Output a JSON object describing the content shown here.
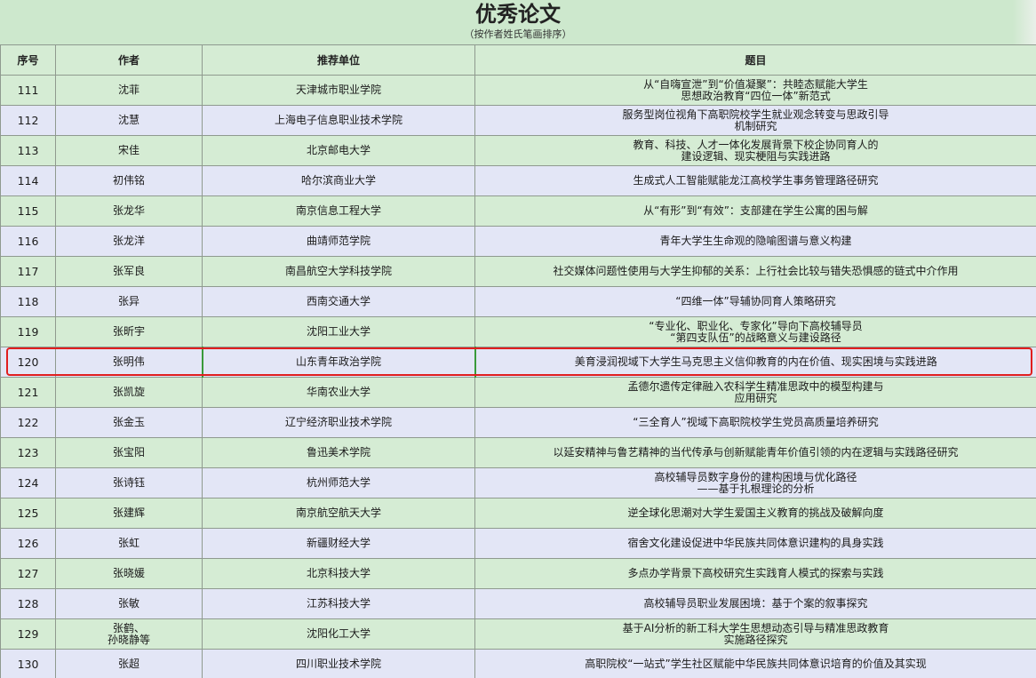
{
  "header": {
    "title": "优秀论文",
    "subtitle": "（按作者姓氏笔画排序）"
  },
  "columns": [
    "序号",
    "作者",
    "推荐单位",
    "题目"
  ],
  "rows": [
    {
      "seq": "111",
      "author": [
        "沈菲"
      ],
      "unit": "天津城市职业学院",
      "topic": [
        "从“自嗨宣泄”到“价值凝聚”：共睦态赋能大学生",
        "思想政治教育“四位一体”新范式"
      ]
    },
    {
      "seq": "112",
      "author": [
        "沈慧"
      ],
      "unit": "上海电子信息职业技术学院",
      "topic": [
        "服务型岗位视角下高职院校学生就业观念转变与思政引导",
        "机制研究"
      ]
    },
    {
      "seq": "113",
      "author": [
        "宋佳"
      ],
      "unit": "北京邮电大学",
      "topic": [
        "教育、科技、人才一体化发展背景下校企协同育人的",
        "建设逻辑、现实梗阻与实践进路"
      ]
    },
    {
      "seq": "114",
      "author": [
        "初伟铭"
      ],
      "unit": "哈尔滨商业大学",
      "topic": [
        "生成式人工智能赋能龙江高校学生事务管理路径研究"
      ]
    },
    {
      "seq": "115",
      "author": [
        "张龙华"
      ],
      "unit": "南京信息工程大学",
      "topic": [
        "从“有形”到“有效”：支部建在学生公寓的困与解"
      ]
    },
    {
      "seq": "116",
      "author": [
        "张龙洋"
      ],
      "unit": "曲靖师范学院",
      "topic": [
        "青年大学生生命观的隐喻图谱与意义构建"
      ]
    },
    {
      "seq": "117",
      "author": [
        "张军良"
      ],
      "unit": "南昌航空大学科技学院",
      "topic": [
        "社交媒体问题性使用与大学生抑郁的关系：上行社会比较与错失恐惧感的链式中介作用"
      ]
    },
    {
      "seq": "118",
      "author": [
        "张异"
      ],
      "unit": "西南交通大学",
      "topic": [
        "“四维一体”导辅协同育人策略研究"
      ]
    },
    {
      "seq": "119",
      "author": [
        "张昕宇"
      ],
      "unit": "沈阳工业大学",
      "topic": [
        "“专业化、职业化、专家化”导向下高校辅导员",
        "“第四支队伍”的战略意义与建设路径"
      ]
    },
    {
      "seq": "120",
      "author": [
        "张明伟"
      ],
      "unit": "山东青年政治学院",
      "topic": [
        "美育浸润视域下大学生马克思主义信仰教育的内在价值、现实困境与实践进路"
      ]
    },
    {
      "seq": "121",
      "author": [
        "张凯旋"
      ],
      "unit": "华南农业大学",
      "topic": [
        "孟德尔遗传定律融入农科学生精准思政中的模型构建与",
        "应用研究"
      ]
    },
    {
      "seq": "122",
      "author": [
        "张金玉"
      ],
      "unit": "辽宁经济职业技术学院",
      "topic": [
        "“三全育人”视域下高职院校学生党员高质量培养研究"
      ]
    },
    {
      "seq": "123",
      "author": [
        "张宝阳"
      ],
      "unit": "鲁迅美术学院",
      "topic": [
        "以延安精神与鲁艺精神的当代传承与创新赋能青年价值引领的内在逻辑与实践路径研究"
      ]
    },
    {
      "seq": "124",
      "author": [
        "张诗钰"
      ],
      "unit": "杭州师范大学",
      "topic": [
        "高校辅导员数字身份的建构困境与优化路径",
        "——基于扎根理论的分析"
      ]
    },
    {
      "seq": "125",
      "author": [
        "张建辉"
      ],
      "unit": "南京航空航天大学",
      "topic": [
        "逆全球化思潮对大学生爱国主义教育的挑战及破解向度"
      ]
    },
    {
      "seq": "126",
      "author": [
        "张虹"
      ],
      "unit": "新疆财经大学",
      "topic": [
        "宿舍文化建设促进中华民族共同体意识建构的具身实践"
      ]
    },
    {
      "seq": "127",
      "author": [
        "张晓媛"
      ],
      "unit": "北京科技大学",
      "topic": [
        "多点办学背景下高校研究生实践育人模式的探索与实践"
      ]
    },
    {
      "seq": "128",
      "author": [
        "张敏"
      ],
      "unit": "江苏科技大学",
      "topic": [
        "高校辅导员职业发展困境：基于个案的叙事探究"
      ]
    },
    {
      "seq": "129",
      "author": [
        "张鹤、",
        "孙晓静等"
      ],
      "unit": "沈阳化工大学",
      "topic": [
        "基于AI分析的新工科大学生思想动态引导与精准思政教育",
        "实施路径探究"
      ]
    },
    {
      "seq": "130",
      "author": [
        "张超"
      ],
      "unit": "四川职业技术学院",
      "topic": [
        "高职院校“一站式”学生社区赋能中华民族共同体意识培育的价值及其实现"
      ]
    }
  ],
  "selected_seq": "120",
  "colors": {
    "row_green": "#d5ecd4",
    "row_blue": "#e3e6f6",
    "highlight": "#e01e1e"
  }
}
